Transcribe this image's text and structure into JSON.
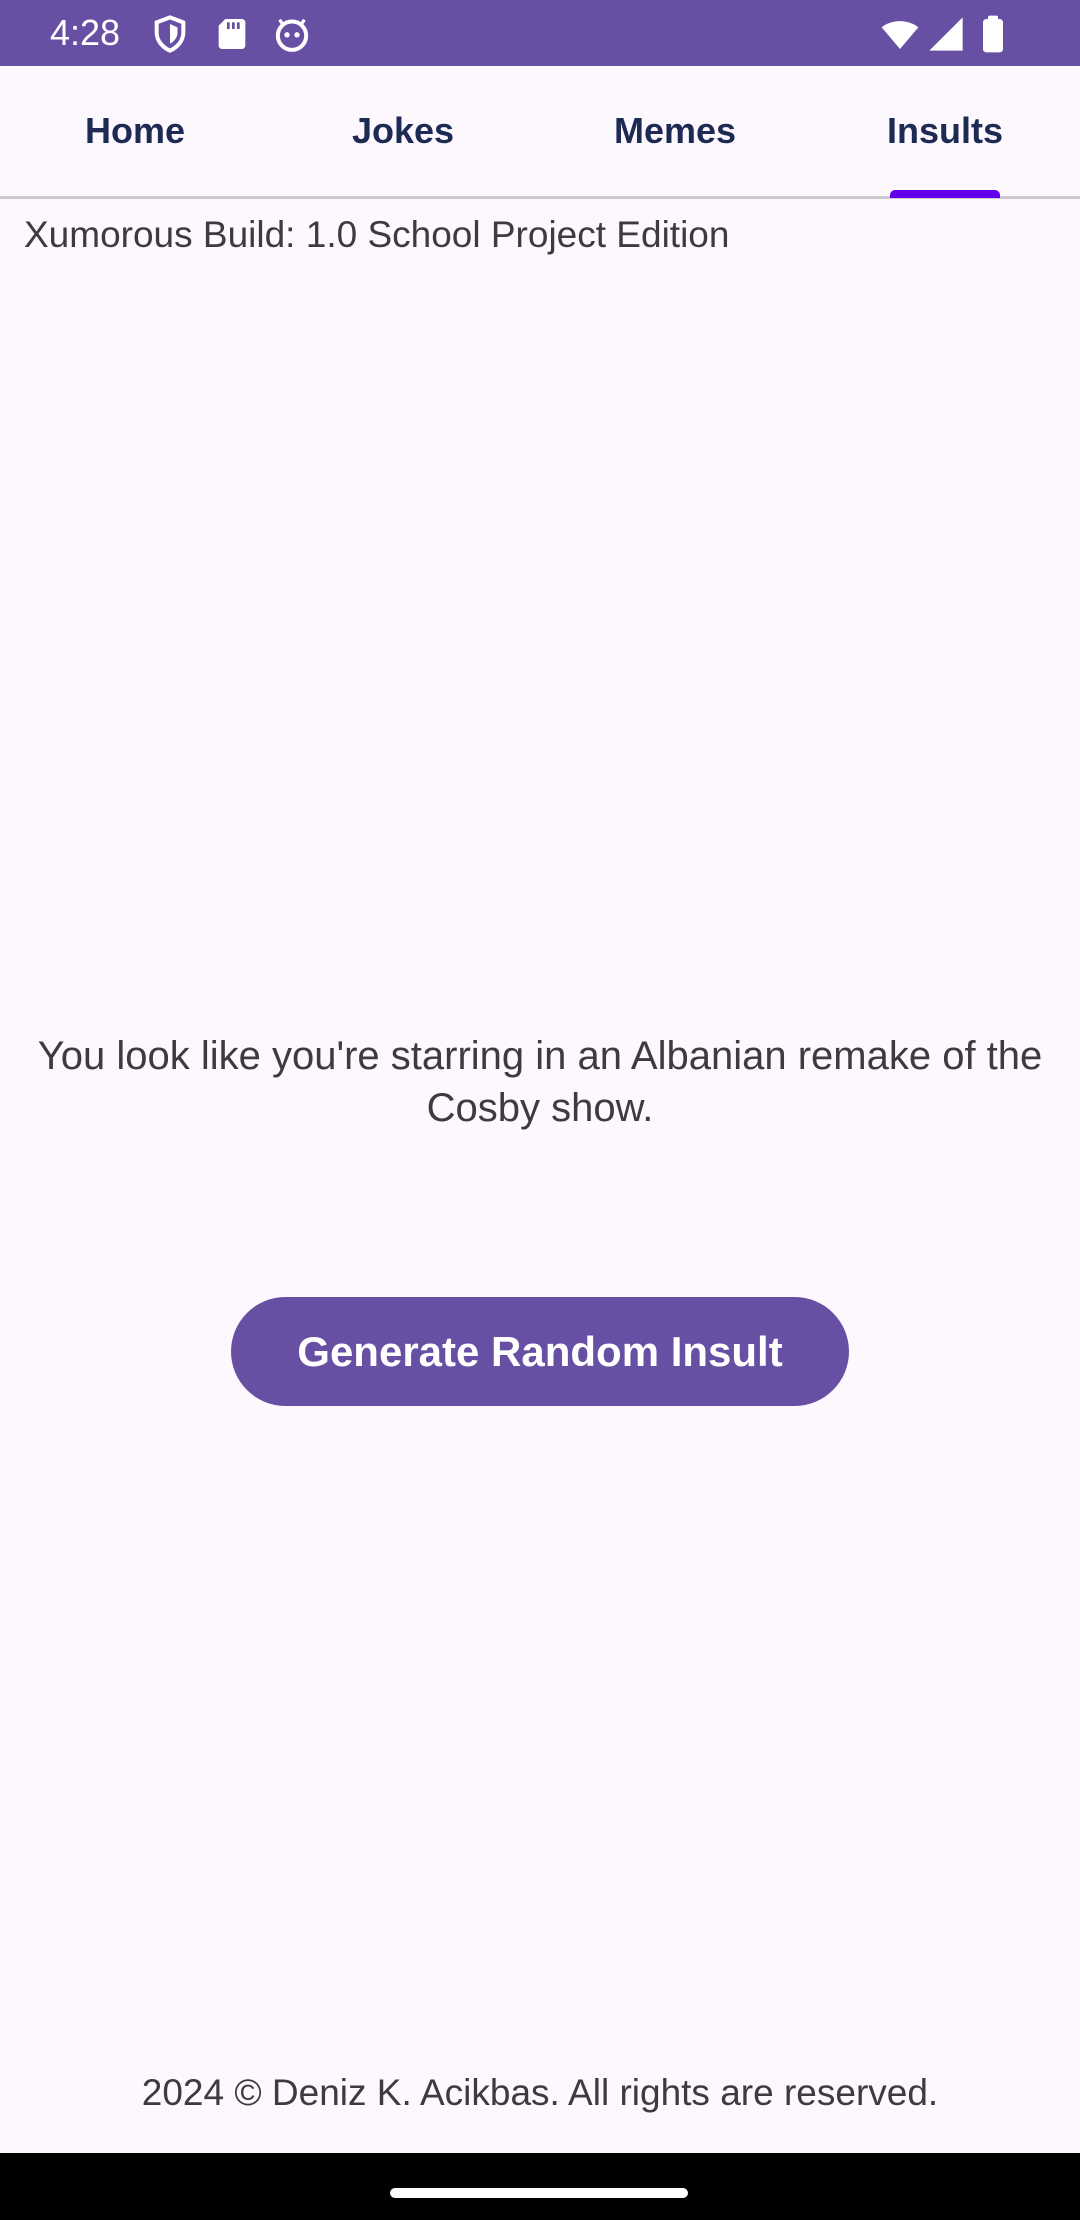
{
  "status_bar": {
    "time": "4:28",
    "background": "#6750A4",
    "icons_left": [
      "shield-icon",
      "sd-card-icon",
      "android-face-icon"
    ],
    "icons_right": [
      "wifi-icon",
      "signal-icon",
      "battery-icon"
    ]
  },
  "tabs": [
    {
      "label": "Home",
      "selected": false
    },
    {
      "label": "Jokes",
      "selected": false
    },
    {
      "label": "Memes",
      "selected": false
    },
    {
      "label": "Insults",
      "selected": true
    }
  ],
  "main": {
    "build_label": "Xumorous Build: 1.0 School Project Edition",
    "insult_text": "You look like you're starring in an Albanian remake of the Cosby show.",
    "generate_button_label": "Generate Random Insult"
  },
  "footer": {
    "copyright": "2024 © Deniz K. Acikbas. All rights are reserved."
  },
  "colors": {
    "accent": "#6750A4",
    "tab_indicator": "#6200EE",
    "tab_text": "#1D2A53",
    "background": "#FDF7FE",
    "body_text": "#3D3A40"
  }
}
